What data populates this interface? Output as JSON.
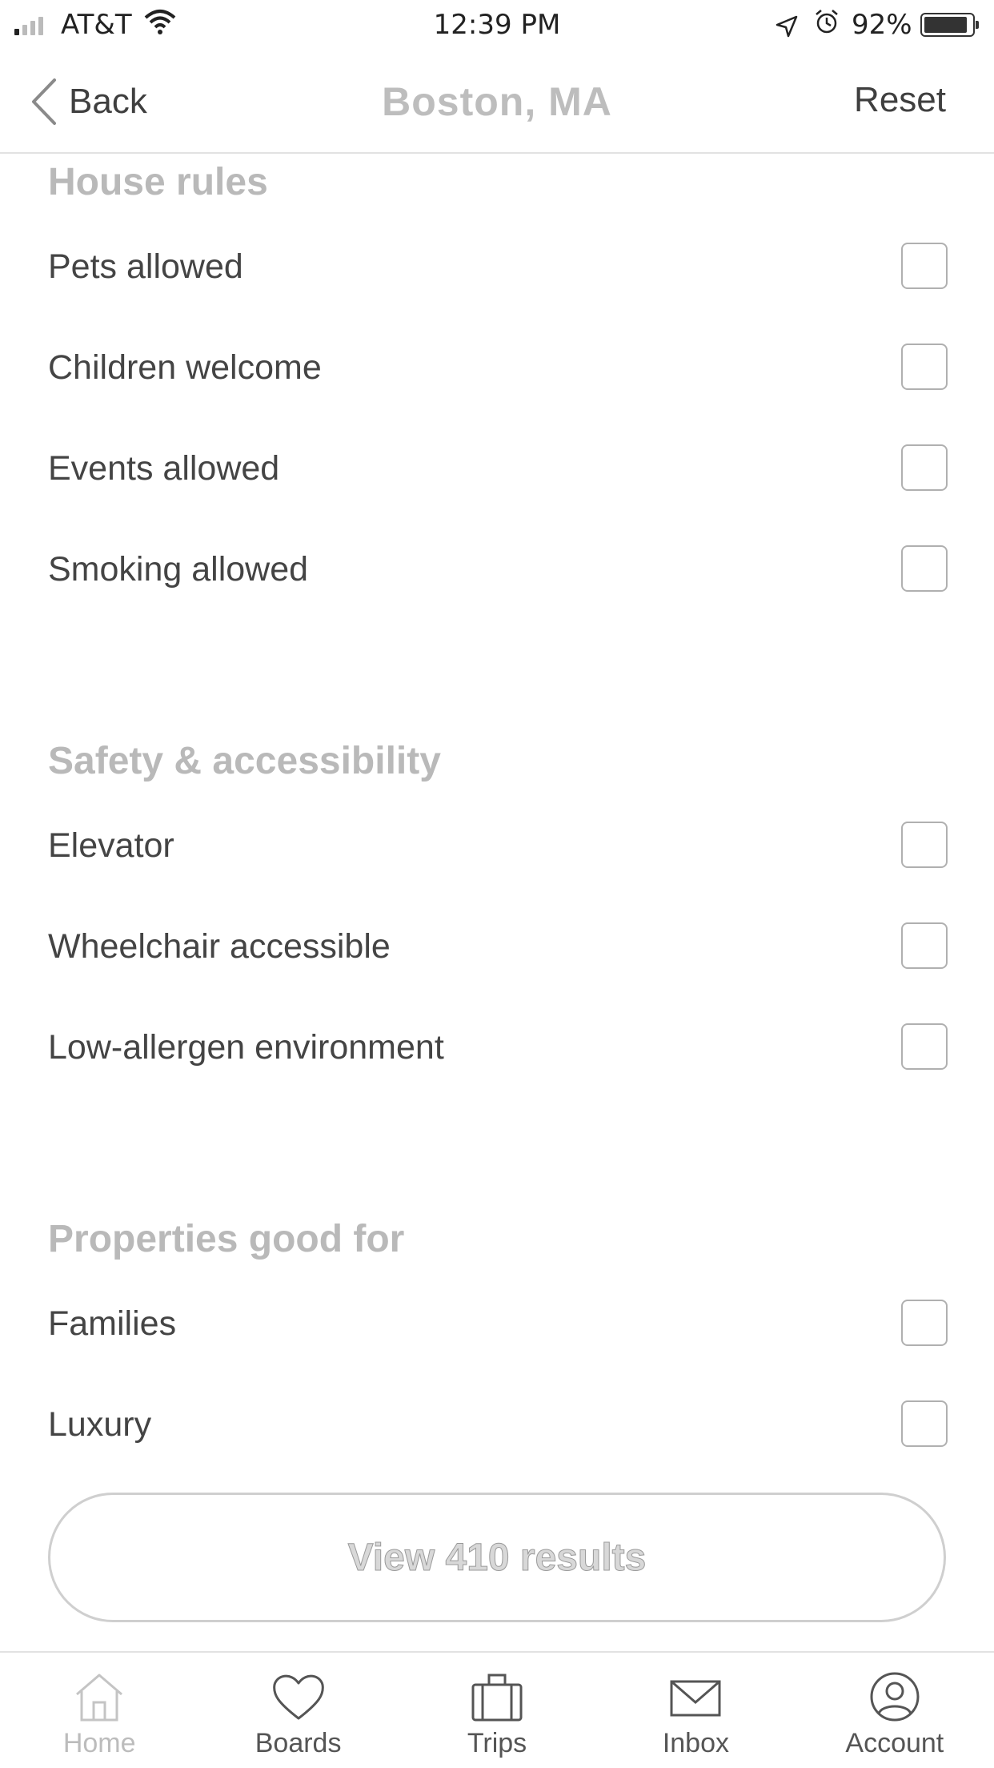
{
  "status_bar": {
    "carrier": "AT&T",
    "time": "12:39 PM",
    "battery_percent": "92%",
    "battery_level": 0.92,
    "signal_bars_on": 1,
    "icons": [
      "signal-icon",
      "wifi-icon",
      "location-arrow-icon",
      "alarm-icon",
      "battery-icon"
    ]
  },
  "nav": {
    "back_label": "Back",
    "title": "Boston,  MA",
    "reset_label": "Reset"
  },
  "sections": [
    {
      "title": "House rules",
      "options": [
        {
          "label": "Pets allowed",
          "checked": false
        },
        {
          "label": "Children welcome",
          "checked": false
        },
        {
          "label": "Events allowed",
          "checked": false
        },
        {
          "label": "Smoking allowed",
          "checked": false
        }
      ]
    },
    {
      "title": "Safety & accessibility",
      "options": [
        {
          "label": "Elevator",
          "checked": false
        },
        {
          "label": "Wheelchair accessible",
          "checked": false
        },
        {
          "label": "Low-allergen environment",
          "checked": false
        }
      ]
    },
    {
      "title": "Properties good for",
      "options": [
        {
          "label": "Families",
          "checked": false
        },
        {
          "label": "Luxury",
          "checked": false
        }
      ]
    }
  ],
  "results_button": {
    "label": "View 410 results"
  },
  "tab_bar": {
    "tabs": [
      {
        "label": "Home",
        "icon": "home-icon",
        "active": true
      },
      {
        "label": "Boards",
        "icon": "heart-icon",
        "active": false
      },
      {
        "label": "Trips",
        "icon": "suitcase-icon",
        "active": false
      },
      {
        "label": "Inbox",
        "icon": "envelope-icon",
        "active": false
      },
      {
        "label": "Account",
        "icon": "user-circle-icon",
        "active": false
      }
    ]
  }
}
